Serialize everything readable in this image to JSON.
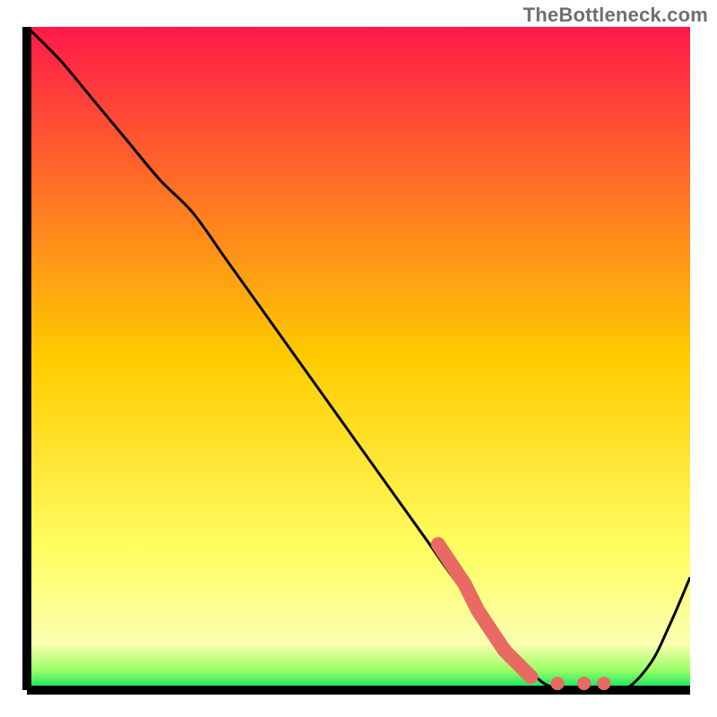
{
  "watermark": "TheBottleneck.com",
  "chart_data": {
    "type": "line",
    "title": "",
    "xlabel": "",
    "ylabel": "",
    "xlim": [
      0,
      100
    ],
    "ylim": [
      0,
      100
    ],
    "gradient_stops": [
      {
        "offset": 0.0,
        "color": "#ff1949"
      },
      {
        "offset": 0.5,
        "color": "#ffcc00"
      },
      {
        "offset": 0.8,
        "color": "#ffff66"
      },
      {
        "offset": 0.93,
        "color": "#fbffb0"
      },
      {
        "offset": 0.97,
        "color": "#9aff66"
      },
      {
        "offset": 1.0,
        "color": "#00e060"
      }
    ],
    "series": [
      {
        "name": "bottleneck-curve",
        "x": [
          0,
          5,
          10,
          15,
          20,
          25,
          30,
          35,
          40,
          45,
          50,
          55,
          60,
          65,
          70,
          74,
          78,
          82,
          86,
          90,
          94,
          97,
          100
        ],
        "y": [
          100,
          95,
          89,
          83,
          77,
          72,
          65,
          58,
          51,
          44,
          37,
          30,
          23,
          16,
          10,
          5,
          1,
          0,
          0,
          0,
          4,
          10,
          17
        ]
      },
      {
        "name": "highlight-band",
        "x": [
          62,
          64,
          66,
          68,
          70,
          72,
          74,
          76,
          80,
          84,
          87
        ],
        "y": [
          22,
          19,
          16,
          12,
          9,
          6,
          4,
          2,
          1,
          1,
          1
        ]
      }
    ]
  }
}
